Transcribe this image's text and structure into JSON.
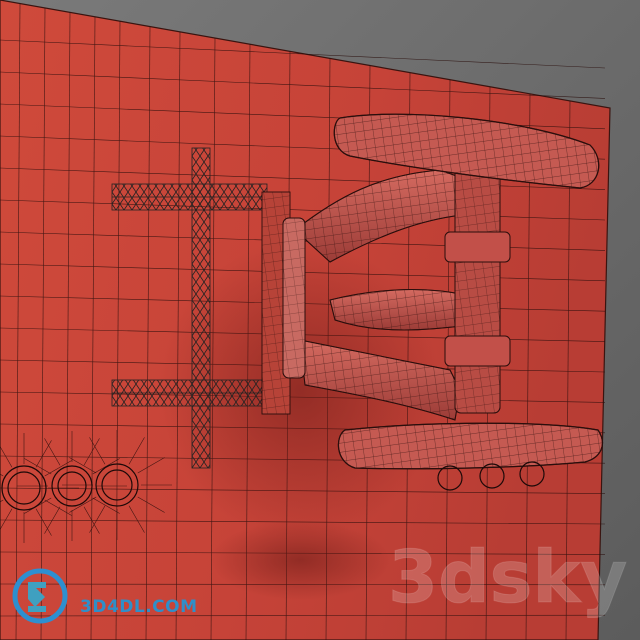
{
  "logo": {
    "text": "3D4DL.COM",
    "mark_color": "#2e8fd0",
    "mark_color_2": "#3fa0c0"
  },
  "watermark": {
    "text": "3dsky"
  },
  "colors": {
    "background": "#6e6e6e",
    "panel": "#c8463a",
    "wire": "#000000",
    "mount": "#b8504c"
  }
}
